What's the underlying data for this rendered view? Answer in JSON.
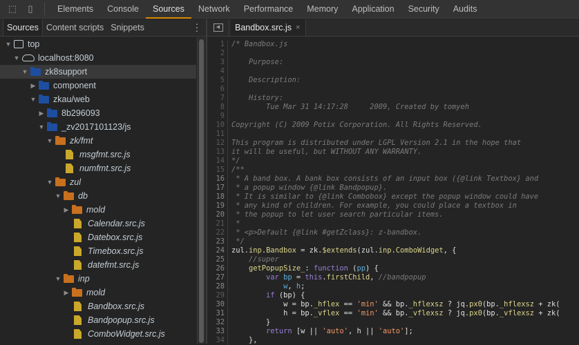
{
  "toolbar": {
    "icons": [
      "inspect-element-icon",
      "device-toolbar-icon"
    ],
    "tabs": [
      "Elements",
      "Console",
      "Sources",
      "Network",
      "Performance",
      "Memory",
      "Application",
      "Security",
      "Audits"
    ],
    "active": "Sources"
  },
  "navigator": {
    "tabs": [
      "Sources",
      "Content scripts",
      "Snippets"
    ],
    "active": "Sources",
    "tree": [
      {
        "label": "top",
        "level": 0,
        "type": "frame",
        "open": true
      },
      {
        "label": "localhost:8080",
        "level": 1,
        "type": "cloud",
        "open": true
      },
      {
        "label": "zk8support",
        "level": 2,
        "type": "blue",
        "open": true,
        "selected": true
      },
      {
        "label": "component",
        "level": 3,
        "type": "blue",
        "open": false
      },
      {
        "label": "zkau/web",
        "level": 3,
        "type": "blue",
        "open": true
      },
      {
        "label": "8b296093",
        "level": 4,
        "type": "blue",
        "open": false
      },
      {
        "label": "_zv2017101123/js",
        "level": 4,
        "type": "blue",
        "open": true
      },
      {
        "label": "zk/fmt",
        "level": 5,
        "type": "orange",
        "open": true
      },
      {
        "label": "msgfmt.src.js",
        "level": 6,
        "type": "file"
      },
      {
        "label": "numfmt.src.js",
        "level": 6,
        "type": "file"
      },
      {
        "label": "zul",
        "level": 5,
        "type": "orange",
        "open": true
      },
      {
        "label": "db",
        "level": 6,
        "type": "orange",
        "open": true
      },
      {
        "label": "mold",
        "level": 7,
        "type": "orange",
        "open": false
      },
      {
        "label": "Calendar.src.js",
        "level": 7,
        "type": "file"
      },
      {
        "label": "Datebox.src.js",
        "level": 7,
        "type": "file"
      },
      {
        "label": "Timebox.src.js",
        "level": 7,
        "type": "file"
      },
      {
        "label": "datefmt.src.js",
        "level": 7,
        "type": "file"
      },
      {
        "label": "inp",
        "level": 6,
        "type": "orange",
        "open": true
      },
      {
        "label": "mold",
        "level": 7,
        "type": "orange",
        "open": false
      },
      {
        "label": "Bandbox.src.js",
        "level": 7,
        "type": "file"
      },
      {
        "label": "Bandpopup.src.js",
        "level": 7,
        "type": "file"
      },
      {
        "label": "ComboWidget.src.js",
        "level": 7,
        "type": "file"
      }
    ]
  },
  "editor": {
    "tab": "Bandbox.src.js",
    "close": "×",
    "lines": [
      [
        [
          "c",
          "/* Bandbox.js"
        ]
      ],
      [],
      [
        [
          "c",
          "    Purpose:"
        ]
      ],
      [],
      [
        [
          "c",
          "    Description:"
        ]
      ],
      [],
      [
        [
          "c",
          "    History:"
        ]
      ],
      [
        [
          "c",
          "        Tue Mar 31 14:17:28     2009, Created by tomyeh"
        ]
      ],
      [],
      [
        [
          "c",
          "Copyright (C) 2009 Potix Corporation. All Rights Reserved."
        ]
      ],
      [],
      [
        [
          "c",
          "This program is distributed under LGPL Version 2.1 in the hope that"
        ]
      ],
      [
        [
          "c",
          "it will be useful, but WITHOUT ANY WARRANTY."
        ]
      ],
      [
        [
          "c",
          "*/"
        ]
      ],
      [
        [
          "c",
          "/**"
        ]
      ],
      [
        [
          "c",
          " * A band box. A bank box consists of an input box ({@link Textbox} and"
        ]
      ],
      [
        [
          "c",
          " * a popup window {@link Bandpopup}."
        ]
      ],
      [
        [
          "c",
          " * It is similar to {@link Combobox} except the popup window could have"
        ]
      ],
      [
        [
          "c",
          " * any kind of children. For example, you could place a textbox in"
        ]
      ],
      [
        [
          "c",
          " * the popup to let user search particular items."
        ]
      ],
      [
        [
          "c",
          " *"
        ]
      ],
      [
        [
          "c",
          " * <p>Default {@link #getZclass}: z-bandbox."
        ]
      ],
      [
        [
          "c",
          " */"
        ]
      ],
      [
        [
          "",
          "zul."
        ],
        [
          "p",
          "inp"
        ],
        [
          "",
          "."
        ],
        [
          "p",
          "Bandbox"
        ],
        [
          "",
          " = zk."
        ],
        [
          "p",
          "$extends"
        ],
        [
          "",
          "(zul."
        ],
        [
          "p",
          "inp"
        ],
        [
          "",
          "."
        ],
        [
          "p",
          "ComboWidget"
        ],
        [
          "",
          ", {"
        ]
      ],
      [
        [
          "c",
          "    //super"
        ]
      ],
      [
        [
          "p",
          "    getPopupSize_"
        ],
        [
          "",
          ": "
        ],
        [
          "k",
          "function"
        ],
        [
          "",
          " ("
        ],
        [
          "v",
          "pp"
        ],
        [
          "",
          ") {"
        ]
      ],
      [
        [
          "k",
          "        var "
        ],
        [
          "v",
          "bp"
        ],
        [
          "",
          " = "
        ],
        [
          "k",
          "this"
        ],
        [
          "",
          "."
        ],
        [
          "p",
          "firstChild"
        ],
        [
          "",
          ", "
        ],
        [
          "c",
          "//bandpopup"
        ]
      ],
      [
        [
          "v",
          "            w"
        ],
        [
          "",
          ", "
        ],
        [
          "v",
          "h"
        ],
        [
          "",
          ";"
        ]
      ],
      [
        [
          "k",
          "        if"
        ],
        [
          "",
          " (bp) {"
        ]
      ],
      [
        [
          "",
          "            w = bp."
        ],
        [
          "p",
          "_hflex"
        ],
        [
          "",
          " == "
        ],
        [
          "s",
          "'min'"
        ],
        [
          "",
          " && bp."
        ],
        [
          "p",
          "_hflexsz"
        ],
        [
          "",
          " ? jq."
        ],
        [
          "p",
          "px0"
        ],
        [
          "",
          "(bp."
        ],
        [
          "p",
          "_hflexsz"
        ],
        [
          "",
          " + zk("
        ]
      ],
      [
        [
          "",
          "            h = bp."
        ],
        [
          "p",
          "_vflex"
        ],
        [
          "",
          " == "
        ],
        [
          "s",
          "'min'"
        ],
        [
          "",
          " && bp."
        ],
        [
          "p",
          "_vflexsz"
        ],
        [
          "",
          " ? jq."
        ],
        [
          "p",
          "px0"
        ],
        [
          "",
          "(bp."
        ],
        [
          "p",
          "_vflexsz"
        ],
        [
          "",
          " + zk("
        ]
      ],
      [
        [
          "",
          "        }"
        ]
      ],
      [
        [
          "k",
          "        return"
        ],
        [
          "",
          " [w || "
        ],
        [
          "s",
          "'auto'"
        ],
        [
          "",
          ", h || "
        ],
        [
          "s",
          "'auto'"
        ],
        [
          "",
          "];"
        ]
      ],
      [
        [
          "",
          "    },"
        ]
      ]
    ]
  }
}
